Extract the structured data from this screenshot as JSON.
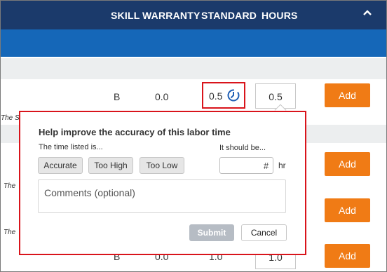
{
  "header": {
    "columns": [
      "SKILL",
      "WARRANTY",
      "STANDARD",
      "HOURS"
    ]
  },
  "row1": {
    "skill": "B",
    "warranty": "0.0",
    "standard": "0.5",
    "hours": "0.5",
    "add_label": "Add",
    "side_text": "The S"
  },
  "rows_partial": [
    {
      "side_text": "The",
      "add_label": "Add"
    },
    {
      "side_text": "The",
      "add_label": "Add"
    }
  ],
  "row_bottom": {
    "skill": "B",
    "warranty": "0.0",
    "standard": "1.0",
    "hours": "1.0",
    "add_label": "Add"
  },
  "popover": {
    "title": "Help improve the accuracy of this labor time",
    "time_listed_label": "The time listed is...",
    "should_be_label": "It should be...",
    "options": [
      "Accurate",
      "Too High",
      "Too Low"
    ],
    "hours_placeholder": "#",
    "hours_unit": "hr",
    "comments_placeholder": "Comments (optional)",
    "submit_label": "Submit",
    "cancel_label": "Cancel"
  },
  "colors": {
    "header_bg": "#1b3a6b",
    "subheader_bg": "#1567b8",
    "accent_orange": "#f07b15",
    "highlight_red": "#d9141b"
  }
}
